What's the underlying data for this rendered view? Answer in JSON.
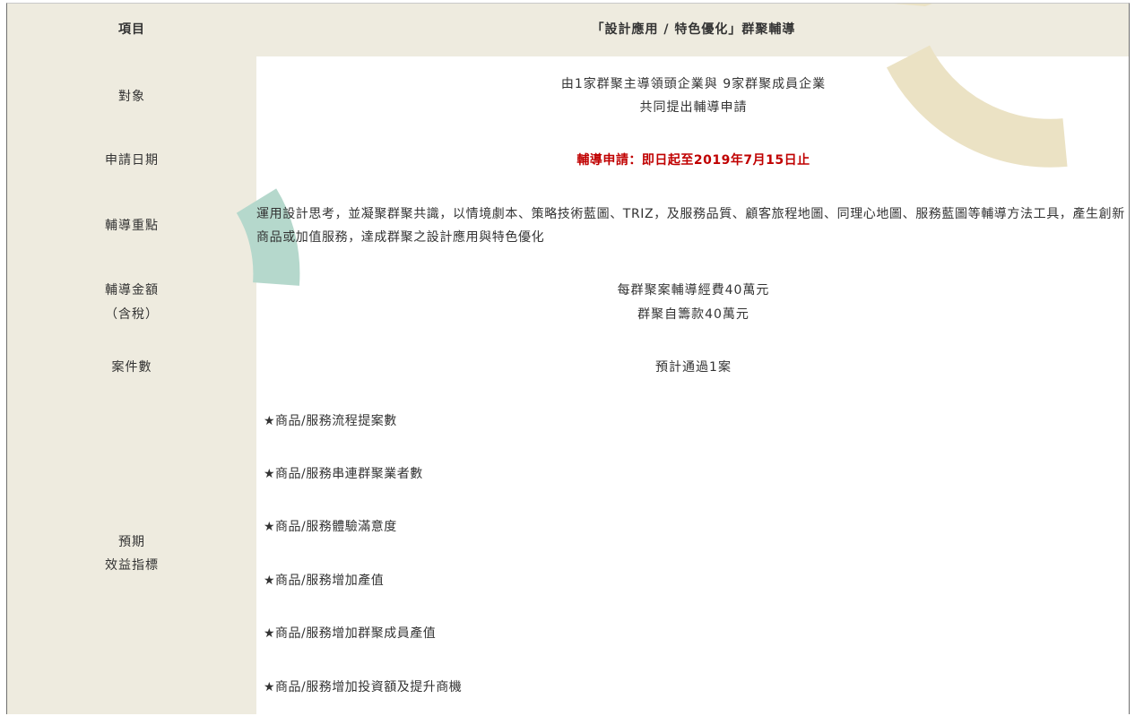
{
  "table": {
    "rows": {
      "item": {
        "label": "項目",
        "value": "「設計應用 / 特色優化」群聚輔導"
      },
      "target": {
        "label": "對象",
        "lines": [
          "由1家群聚主導領頭企業與 9家群聚成員企業",
          "共同提出輔導申請"
        ]
      },
      "date": {
        "label": "申請日期",
        "value": "輔導申請：即日起至2019年7月15日止"
      },
      "focus": {
        "label": "輔導重點",
        "value": "運用設計思考，並凝聚群聚共識，以情境劇本、策略技術藍圖、TRIZ，及服務品質、顧客旅程地圖、同理心地圖、服務藍圖等輔導方法工具，產生創新商品或加值服務，達成群聚之設計應用與特色優化"
      },
      "amount": {
        "label_lines": [
          "輔導金額",
          "（含稅）"
        ],
        "lines": [
          "每群聚案輔導經費40萬元",
          "群聚自籌款40萬元"
        ]
      },
      "cases": {
        "label": "案件數",
        "value": "預計通過1案"
      },
      "kpi": {
        "label_lines": [
          "預期",
          "效益指標"
        ],
        "items": [
          "★商品/服務流程提案數",
          "★商品/服務串連群聚業者數",
          "★商品/服務體驗滿意度",
          "★商品/服務增加產值",
          "★商品/服務增加群聚成員產值",
          "★商品/服務增加投資額及提升商機"
        ]
      }
    }
  },
  "colors": {
    "label_bg": "#eeebdf",
    "highlight": "#c00000",
    "decor_beige": "#ebe2c4",
    "decor_teal": "#b5d8cc"
  }
}
